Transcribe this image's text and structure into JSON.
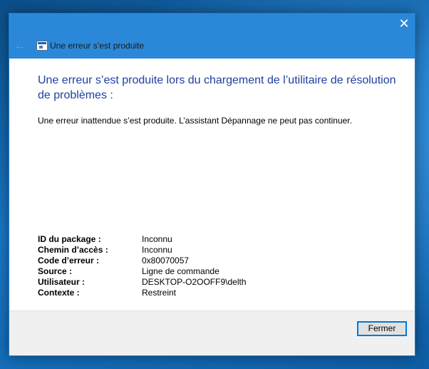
{
  "window": {
    "close_glyph": "✕",
    "back_glyph": "←",
    "nav_title": "Une erreur s’est produite"
  },
  "content": {
    "heading": "Une erreur s’est produite lors du chargement de l’utilitaire de résolution de problèmes :",
    "message": "Une erreur inattendue s’est produite. L’assistant Dépannage ne peut pas continuer."
  },
  "details": [
    {
      "label": "ID du package :",
      "value": "Inconnu"
    },
    {
      "label": "Chemin d’accès :",
      "value": "Inconnu"
    },
    {
      "label": "Code d’erreur :",
      "value": "0x80070057"
    },
    {
      "label": "Source :",
      "value": "Ligne de commande"
    },
    {
      "label": "Utilisateur :",
      "value": "DESKTOP-O2OOFF9\\delth"
    },
    {
      "label": "Contexte :",
      "value": "Restreint"
    }
  ],
  "footer": {
    "close_label": "Fermer"
  },
  "colors": {
    "titlebar": "#2b88d8",
    "heading": "#1e3f9e",
    "button_border": "#0078d7"
  },
  "icons": {
    "close": "close-icon",
    "back": "back-arrow-icon",
    "app": "troubleshooter-app-icon"
  }
}
